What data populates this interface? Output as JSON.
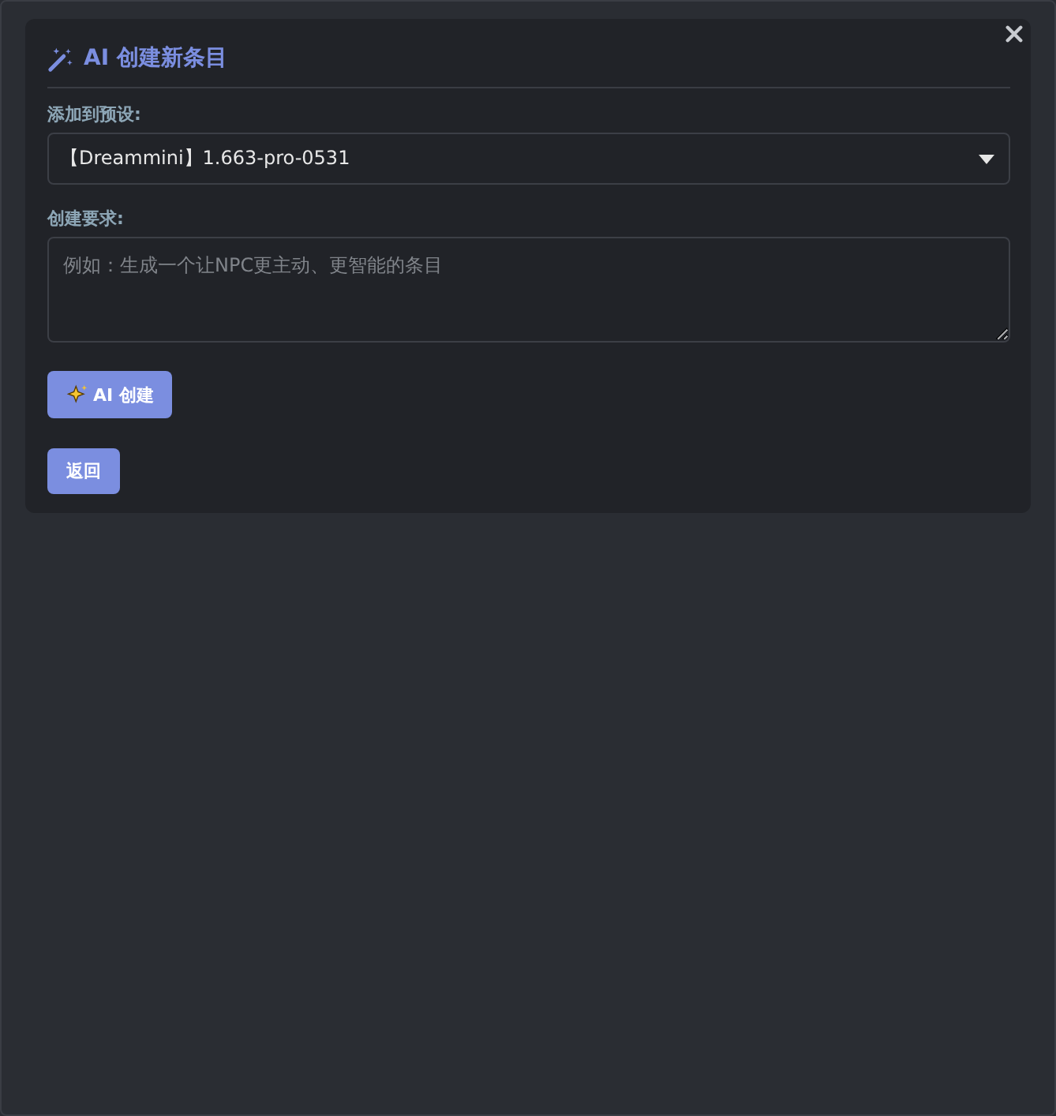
{
  "dialog": {
    "title": "AI 创建新条目",
    "preset": {
      "label": "添加到预设:",
      "value": "【Dreammini】1.663-pro-0531"
    },
    "request": {
      "label": "创建要求:",
      "placeholder": "例如：生成一个让NPC更主动、更智能的条目"
    },
    "buttons": [
      {
        "kind": "create",
        "label": "AI 创建"
      },
      {
        "kind": "back",
        "label": "返回"
      }
    ]
  }
}
